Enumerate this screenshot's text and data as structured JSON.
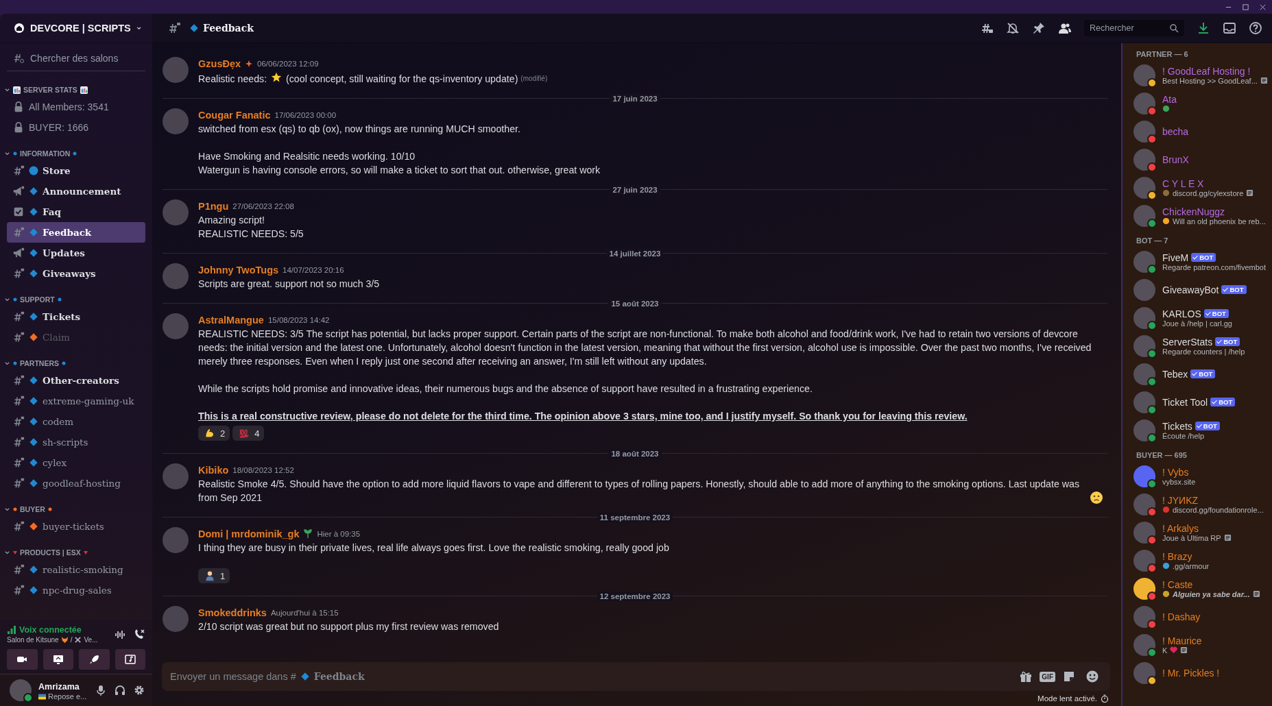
{
  "server": {
    "name": "DEVCORE | SCRIPTS"
  },
  "sidebar": {
    "search": "Chercher des salons",
    "categories": [
      {
        "name": "SERVER STATS",
        "marker": {
          "kind": "chart",
          "color": "#3aa0d8"
        },
        "expanded": true,
        "channels": [
          {
            "name": "All Members: 3541",
            "kind": "locked",
            "unread": false,
            "muted": false,
            "selected": false
          },
          {
            "name": "BUYER: 1666",
            "kind": "locked",
            "unread": false,
            "muted": false,
            "selected": false
          }
        ]
      },
      {
        "name": "INFORMATION",
        "marker": {
          "kind": "dot",
          "color": "#1f8ad2"
        },
        "expanded": true,
        "channels": [
          {
            "name": "Store",
            "kind": "text",
            "marker": {
              "kind": "circle",
              "color": "#1f8ad2"
            },
            "unread": true,
            "muted": false,
            "selected": false
          },
          {
            "name": "Announcement",
            "kind": "announcement",
            "marker": {
              "kind": "diamond",
              "color": "#1f8ad2"
            },
            "unread": true,
            "muted": false,
            "selected": false
          },
          {
            "name": "Faq",
            "kind": "checklist",
            "marker": {
              "kind": "diamond",
              "color": "#1f8ad2"
            },
            "unread": true,
            "muted": false,
            "selected": false
          },
          {
            "name": "Feedback",
            "kind": "text",
            "marker": {
              "kind": "diamond",
              "color": "#1f8ad2"
            },
            "unread": true,
            "muted": false,
            "selected": true
          },
          {
            "name": "Updates",
            "kind": "announcement",
            "marker": {
              "kind": "diamond",
              "color": "#1f8ad2"
            },
            "unread": true,
            "muted": false,
            "selected": false
          },
          {
            "name": "Giveaways",
            "kind": "text",
            "marker": {
              "kind": "diamond",
              "color": "#1f8ad2"
            },
            "unread": true,
            "muted": false,
            "selected": false
          }
        ]
      },
      {
        "name": "SUPPORT",
        "marker": {
          "kind": "dot",
          "color": "#1f8ad2"
        },
        "expanded": true,
        "channels": [
          {
            "name": "Tickets",
            "kind": "text",
            "marker": {
              "kind": "diamond",
              "color": "#1f8ad2"
            },
            "unread": true,
            "muted": false,
            "selected": false
          },
          {
            "name": "Claim",
            "kind": "text",
            "marker": {
              "kind": "diamond",
              "color": "#f26c22"
            },
            "unread": false,
            "muted": true,
            "selected": false
          }
        ]
      },
      {
        "name": "PARTNERS",
        "marker": {
          "kind": "dot",
          "color": "#1f8ad2"
        },
        "expanded": true,
        "channels": [
          {
            "name": "Other-creators",
            "kind": "text",
            "marker": {
              "kind": "diamond",
              "color": "#1f8ad2"
            },
            "unread": true,
            "muted": false,
            "selected": false
          },
          {
            "name": "extreme-gaming-uk",
            "kind": "text",
            "marker": {
              "kind": "diamond",
              "color": "#1f8ad2"
            },
            "unread": false,
            "muted": false,
            "selected": false
          },
          {
            "name": "codem",
            "kind": "text",
            "marker": {
              "kind": "diamond",
              "color": "#1f8ad2"
            },
            "unread": false,
            "muted": false,
            "selected": false
          },
          {
            "name": "sh-scripts",
            "kind": "text",
            "marker": {
              "kind": "diamond",
              "color": "#1f8ad2"
            },
            "unread": false,
            "muted": false,
            "selected": false
          },
          {
            "name": "cylex",
            "kind": "text",
            "marker": {
              "kind": "diamond",
              "color": "#1f8ad2"
            },
            "unread": false,
            "muted": false,
            "selected": false
          },
          {
            "name": "goodleaf-hosting",
            "kind": "text",
            "marker": {
              "kind": "diamond",
              "color": "#1f8ad2"
            },
            "unread": false,
            "muted": false,
            "selected": false
          }
        ]
      },
      {
        "name": "BUYER",
        "marker": {
          "kind": "dot",
          "color": "#f26c22"
        },
        "expanded": true,
        "channels": [
          {
            "name": "buyer-tickets",
            "kind": "text",
            "marker": {
              "kind": "diamond",
              "color": "#f26c22"
            },
            "unread": false,
            "muted": false,
            "selected": false
          }
        ]
      },
      {
        "name": "PRODUCTS | ESX",
        "marker": {
          "kind": "triangle",
          "color": "#e0303a"
        },
        "expanded": true,
        "channels": [
          {
            "name": "realistic-smoking",
            "kind": "text",
            "marker": {
              "kind": "diamond",
              "color": "#1f8ad2"
            },
            "unread": false,
            "muted": false,
            "selected": false
          },
          {
            "name": "npc-drug-sales",
            "kind": "text",
            "marker": {
              "kind": "diamond",
              "color": "#1f8ad2"
            },
            "unread": false,
            "muted": false,
            "selected": false
          }
        ]
      }
    ]
  },
  "voice": {
    "status": "Voix connectée",
    "channel": "Salon de Kitsune",
    "separator": "/",
    "sub_channel": "Ve..."
  },
  "user": {
    "name": "Amrizama",
    "status_text": "Repose e...",
    "presence": {
      "kind": "online"
    }
  },
  "header": {
    "channel": "Feedback",
    "search_placeholder": "Rechercher"
  },
  "messages": [
    {
      "author": "GzusĐẹx",
      "author_icon": {
        "kind": "sparkle"
      },
      "time": "06/06/2023 12:09",
      "paragraphs": [
        {
          "kind": "plain",
          "text": "Realistic needs: ",
          "emoji": {
            "kind": "star"
          },
          "after": " (cool concept, still waiting for the qs-inventory update)"
        }
      ],
      "edited": "(modifié)"
    },
    {
      "divider_before": "17 juin 2023",
      "author": "Cougar Fanatic",
      "time": "17/06/2023 00:00",
      "paragraphs": [
        {
          "kind": "plain",
          "text": "switched from esx (qs) to qb (ox), now things are running MUCH smoother."
        },
        {
          "kind": "plain",
          "text": "Have Smoking and Realsitic needs working. 10/10\nWatergun is having console errors, so will make a ticket to sort that out. otherwise, great work"
        }
      ]
    },
    {
      "divider_before": "27 juin 2023",
      "author": "P1ngu",
      "time": "27/06/2023 22:08",
      "paragraphs": [
        {
          "kind": "plain",
          "text": "Amazing script!\nREALISTIC NEEDS: 5/5"
        }
      ]
    },
    {
      "divider_before": "14 juillet 2023",
      "author": "Johnny TwoTugs",
      "time": "14/07/2023 20:16",
      "paragraphs": [
        {
          "kind": "plain",
          "text": "Scripts are great. support not so much 3/5"
        }
      ]
    },
    {
      "divider_before": "15 août 2023",
      "author": "AstralMangue",
      "time": "15/08/2023 14:42",
      "paragraphs": [
        {
          "kind": "plain",
          "text": "REALISTIC NEEDS: 3/5 The script has potential, but lacks proper support. Certain parts of the script are non-functional. To make both alcohol and food/drink work, I've had to retain two versions of devcore needs: the initial version and the latest one. Unfortunately, alcohol doesn't function in the latest version, meaning that without the first version, alcohol use is impossible. Over the past two months, I've received merely three responses. Even when I reply just one second after receiving an answer, I'm still left without any updates."
        },
        {
          "kind": "plain",
          "text": "While the scripts hold promise and innovative ideas, their numerous bugs and the absence of support have resulted in a frustrating experience."
        },
        {
          "kind": "strong",
          "text": "This is a real constructive review, please do not delete for the third time. The opinion above 3 stars, mine too, and I justify myself. So thank you for leaving this review."
        }
      ],
      "reactions": [
        {
          "emoji": {
            "kind": "muscle"
          },
          "count": "2"
        },
        {
          "emoji": {
            "kind": "hundred"
          },
          "count": "4"
        }
      ]
    },
    {
      "divider_before": "18 août 2023",
      "author": "Kibiko",
      "time": "18/08/2023 12:52",
      "paragraphs": [
        {
          "kind": "plain",
          "text": "Realistic Smoke 4/5. Should have the option to add more liquid flavors to vape and different to types of rolling papers. Honestly, should able to add more of anything to the smoking options. Last update was from Sep 2021",
          "emoji": {
            "kind": "sad"
          }
        }
      ]
    },
    {
      "divider_before": "11 septembre 2023",
      "author": "Domi | mrdominik_gk",
      "author_icon": {
        "kind": "leaf"
      },
      "time": "Hier à 09:35",
      "paragraphs": [
        {
          "kind": "plain",
          "text": "I thing they are busy in their private lives, real life always goes first. Love the realistic smoking, really good job"
        }
      ],
      "reactions": [
        {
          "emoji": {
            "kind": "person"
          },
          "count": "1"
        }
      ]
    },
    {
      "divider_before": "12 septembre 2023",
      "author": "Smokeddrinks",
      "time": "Aujourd'hui à 15:15",
      "paragraphs": [
        {
          "kind": "plain",
          "text": "2/10 script was great but no support plus my first review was removed"
        }
      ]
    }
  ],
  "composer": {
    "placeholder": "Envoyer un message dans #",
    "channel": "Feedback",
    "gif_label": "GIF"
  },
  "slow_mode": "Mode lent activé.",
  "member_groups": [
    {
      "title": "PARTNER — 6",
      "color": "#b36ae2",
      "members": [
        {
          "name": "! GoodLeaf Hosting !",
          "avatar": {
            "kind": "photo"
          },
          "status": {
            "kind": "idle"
          },
          "activity": "Best Hosting >> GoodLeaf...",
          "note": true
        },
        {
          "name": "Ata",
          "avatar": {
            "kind": "photo"
          },
          "status": {
            "kind": "dnd"
          },
          "activity_icon": {
            "kind": "frog"
          }
        },
        {
          "name": "becha",
          "avatar": {
            "kind": "photo"
          },
          "status": {
            "kind": "dnd"
          }
        },
        {
          "name": "BrunX",
          "avatar": {
            "kind": "photo"
          },
          "status": {
            "kind": "dnd"
          }
        },
        {
          "name": "C Y L E X",
          "avatar": {
            "kind": "photo"
          },
          "status": {
            "kind": "idle"
          },
          "activity_icon": {
            "kind": "music"
          },
          "activity": "discord.gg/cylexstore",
          "note": true
        },
        {
          "name": "ChickenNuggz",
          "avatar": {
            "kind": "photo"
          },
          "status": {
            "kind": "online"
          },
          "activity_icon": {
            "kind": "flame"
          },
          "activity": "Will an old phoenix be reb..."
        }
      ]
    },
    {
      "title": "BOT — 7",
      "color": "#dbdee1",
      "members": [
        {
          "name": "FiveM",
          "avatar": {
            "kind": "photo"
          },
          "status": {
            "kind": "online"
          },
          "badge": "BOT",
          "activity": "Regarde patreon.com/fivembot"
        },
        {
          "name": "GiveawayBot",
          "avatar": {
            "kind": "photo"
          },
          "badge": "BOT"
        },
        {
          "name": "KARLOS",
          "avatar": {
            "kind": "photo"
          },
          "status": {
            "kind": "online"
          },
          "badge": "BOT",
          "activity": "Joue à /help | carl.gg"
        },
        {
          "name": "ServerStats",
          "avatar": {
            "kind": "photo"
          },
          "status": {
            "kind": "online"
          },
          "badge": "BOT",
          "activity": "Regarde counters | /help"
        },
        {
          "name": "Tebex",
          "avatar": {
            "kind": "photo"
          },
          "status": {
            "kind": "online"
          },
          "badge": "BOT"
        },
        {
          "name": "Ticket Tool",
          "avatar": {
            "kind": "photo"
          },
          "status": {
            "kind": "online"
          },
          "badge": "BOT"
        },
        {
          "name": "Tickets",
          "avatar": {
            "kind": "photo"
          },
          "status": {
            "kind": "online"
          },
          "badge": "BOT",
          "activity": "Écoute /help"
        }
      ]
    },
    {
      "title": "BUYER — 695",
      "color": "#e67e22",
      "members": [
        {
          "name": "! Vybs",
          "avatar": {
            "kind": "default-blue"
          },
          "status": {
            "kind": "online"
          },
          "activity": "vybsx.site"
        },
        {
          "name": "! JYИKZ",
          "avatar": {
            "kind": "photo"
          },
          "status": {
            "kind": "dnd"
          },
          "activity_icon": {
            "kind": "flag"
          },
          "activity": "discord.gg/foundationrole..."
        },
        {
          "name": "! Arkalys",
          "avatar": {
            "kind": "photo"
          },
          "status": {
            "kind": "dnd"
          },
          "activity": "Joue à Ultima RP",
          "note": true
        },
        {
          "name": "! Brazy",
          "avatar": {
            "kind": "photo"
          },
          "status": {
            "kind": "dnd"
          },
          "activity_icon": {
            "kind": "shield"
          },
          "activity": ".gg/armour"
        },
        {
          "name": "! Caste",
          "avatar": {
            "kind": "default-yellow"
          },
          "status": {
            "kind": "dnd"
          },
          "activity_icon": {
            "kind": "crown"
          },
          "activity": "Alguien ya sabe dar...",
          "italic": true,
          "note": true
        },
        {
          "name": "! Dashay",
          "avatar": {
            "kind": "photo"
          },
          "status": {
            "kind": "dnd"
          }
        },
        {
          "name": "! Maurice",
          "avatar": {
            "kind": "photo"
          },
          "status": {
            "kind": "online"
          },
          "activity": "K",
          "activity_after": {
            "kind": "heart"
          },
          "note": true
        },
        {
          "name": "! Mr. Pickles !",
          "avatar": {
            "kind": "photo"
          },
          "status": {
            "kind": "idle"
          }
        }
      ]
    }
  ]
}
